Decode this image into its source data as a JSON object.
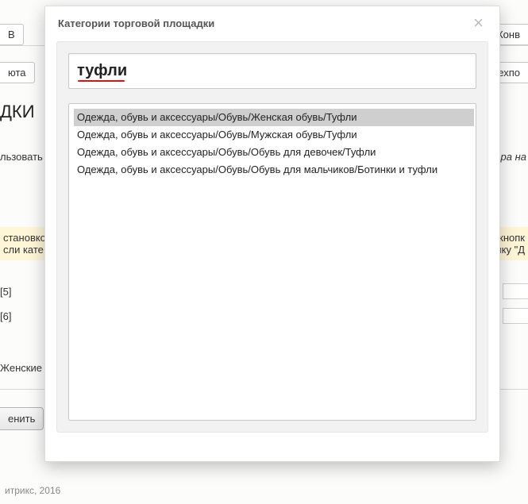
{
  "modal": {
    "title": "Категории торговой площадки",
    "close_glyph": "×",
    "search_value": "туфли",
    "results": [
      {
        "text": "Одежда, обувь и аксессуары/Обувь/Женская обувь/Туфли",
        "selected": true
      },
      {
        "text": "Одежда, обувь и аксессуары/Обувь/Мужская обувь/Туфли",
        "selected": false
      },
      {
        "text": "Одежда, обувь и аксессуары/Обувь/Обувь для девочек/Туфли",
        "selected": false
      },
      {
        "text": "Одежда, обувь и аксессуары/Обувь/Обувь для мальчиков/Ботинки и туфли",
        "selected": false
      }
    ]
  },
  "bg": {
    "tab_top_left": "В",
    "tab_top_right": "Конв",
    "tab_row2_left": "юта",
    "tab_row2_right": "Техпо",
    "heading_frag": "ДКИ",
    "text_use": "льзовать",
    "text_goods": "вара на",
    "hint_line1": "становко",
    "hint_line2": "сли кате",
    "hint_right_line1": "те кнопк",
    "hint_right_line2": "пку \"Д",
    "bracket5": "[5]",
    "bracket6": "[6]",
    "women": "Женские [",
    "btn_apply": "енить",
    "footer": "итрикс, 2016"
  }
}
